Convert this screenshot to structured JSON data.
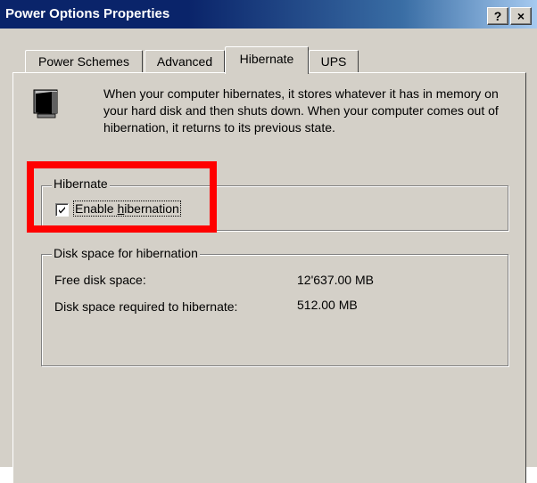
{
  "window": {
    "title": "Power Options Properties",
    "help_button": "?",
    "close_button": "×"
  },
  "tabs": [
    {
      "label": "Power Schemes",
      "active": false
    },
    {
      "label": "Advanced",
      "active": false
    },
    {
      "label": "Hibernate",
      "active": true
    },
    {
      "label": "UPS",
      "active": false
    }
  ],
  "description": "When your computer hibernates, it stores whatever it has in memory on your hard disk and then shuts down. When your computer comes out of hibernation, it returns to its previous state.",
  "hibernate_group": {
    "title": "Hibernate",
    "checkbox_label_prefix": "Enable ",
    "checkbox_label_underlined": "h",
    "checkbox_label_rest": "ibernation",
    "checked": true
  },
  "disk_group": {
    "title": "Disk space for hibernation",
    "free_label": "Free disk space:",
    "free_value": "12'637.00 MB",
    "required_label": "Disk space required to hibernate:",
    "required_value": "512.00 MB"
  },
  "icons": {
    "hibernate": "monitor-moon-icon"
  },
  "colors": {
    "titlebar_start": "#0a246a",
    "titlebar_end": "#a6caf0",
    "dialog_face": "#d4d0c8",
    "highlight": "#ff0000"
  }
}
